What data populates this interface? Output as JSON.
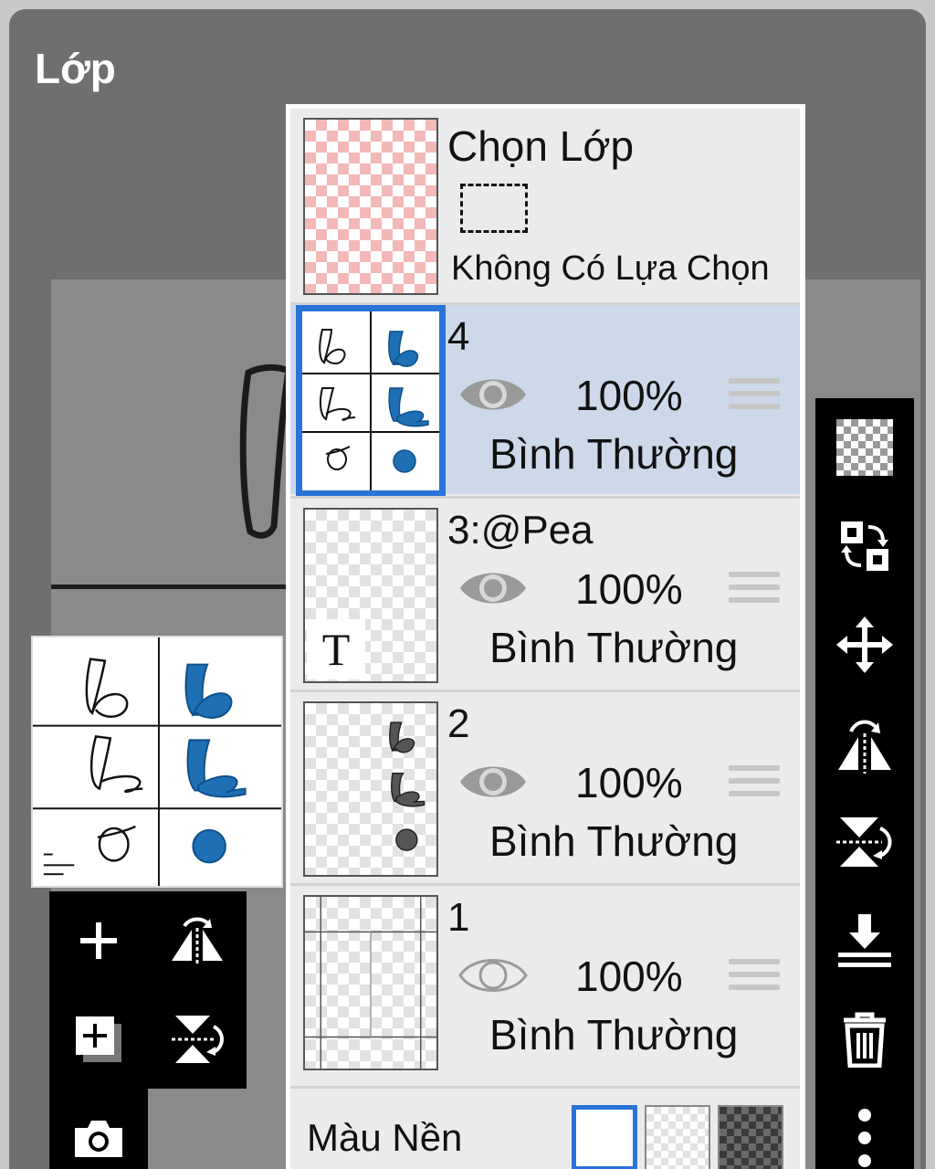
{
  "header": {
    "title": "Lớp"
  },
  "selection": {
    "title": "Chọn Lớp",
    "status": "Không Có Lựa Chọn"
  },
  "layers": [
    {
      "name": "4",
      "visible": true,
      "opacity": "100%",
      "blend": "Bình Thường",
      "active": true
    },
    {
      "name": "3:@Pea",
      "visible": true,
      "opacity": "100%",
      "blend": "Bình Thường",
      "active": false,
      "badge": "T"
    },
    {
      "name": "2",
      "visible": true,
      "opacity": "100%",
      "blend": "Bình Thường",
      "active": false
    },
    {
      "name": "1",
      "visible": false,
      "opacity": "100%",
      "blend": "Bình Thường",
      "active": false
    }
  ],
  "background": {
    "label": "Màu Nền",
    "options": [
      "white",
      "transparent",
      "dark-checker"
    ],
    "selected": "white"
  },
  "left_toolbar": [
    "add-layer-icon",
    "flip-horizontal-icon",
    "add-layer-copy-icon",
    "flip-vertical-icon",
    "camera-icon"
  ],
  "right_toolbar": [
    "transparency-icon",
    "swap-layers-icon",
    "move-icon",
    "flip-horizontal-icon",
    "flip-vertical-icon",
    "merge-down-icon",
    "trash-icon",
    "more-vertical-icon"
  ],
  "colors": {
    "frame": "#6f6f6f",
    "active_row": "#cdd9ea",
    "accent": "#2a73d8",
    "brush_blue": "#1f6fb5"
  }
}
